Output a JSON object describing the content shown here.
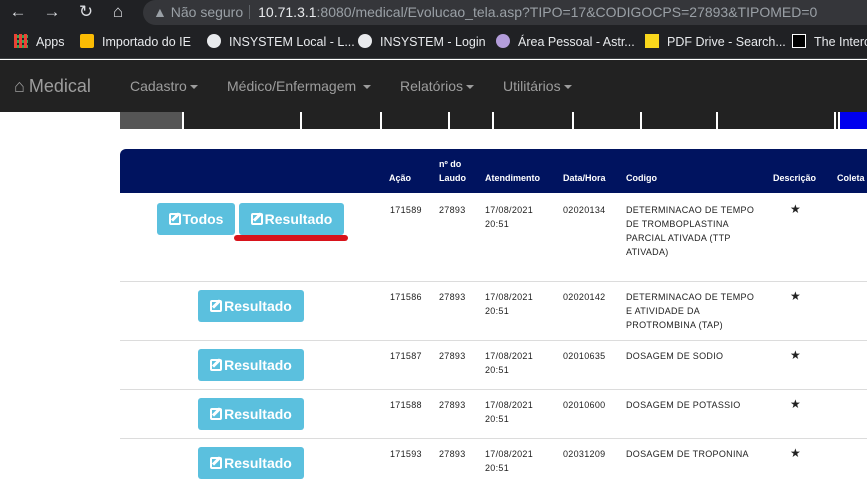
{
  "browser": {
    "security_label": "Não seguro",
    "url_host": "10.71.3.1",
    "url_rest": ":8080/medical/Evolucao_tela.asp?TIPO=17&CODIGOCPS=27893&TIPOMED=0",
    "bookmarks": [
      {
        "label": "Apps",
        "color": "#ea4335"
      },
      {
        "label": "Importado do IE",
        "color": "#fbbc04"
      },
      {
        "label": "INSYSTEM Local - L...",
        "color": "#e8eaed"
      },
      {
        "label": "INSYSTEM - Login",
        "color": "#e8eaed"
      },
      {
        "label": "Área Pessoal - Astr...",
        "color": "#b39ddb"
      },
      {
        "label": "PDF Drive - Search...",
        "color": "#f9d71c"
      },
      {
        "label": "The Interc",
        "color": "#ffffff"
      }
    ]
  },
  "navbar": {
    "brand": "Medical",
    "menus": [
      "Cadastro",
      "Médico/Enfermagem",
      "Relatórios",
      "Utilitários"
    ]
  },
  "table": {
    "headers": {
      "acao": "Ação",
      "laudo_line1": "nº do",
      "laudo_line2": "Laudo",
      "atendimento": "Atendimento",
      "datahora": "Data/Hora",
      "codigo": "Codigo",
      "descricao": "Descrição",
      "coleta": "Coleta"
    },
    "buttons": {
      "todos": "Todos",
      "resultado": "Resultado"
    },
    "star": "★",
    "rows": [
      {
        "acao": "171589",
        "laudo": "27893",
        "date": "17/08/2021",
        "time": "20:51",
        "datahora": "02020134",
        "codigo": "DETERMINACAO DE TEMPO DE TROMBOPLASTINA PARCIAL ATIVADA (TTP ATIVADA)"
      },
      {
        "acao": "171586",
        "laudo": "27893",
        "date": "17/08/2021",
        "time": "20:51",
        "datahora": "02020142",
        "codigo": "DETERMINACAO DE TEMPO E ATIVIDADE DA PROTROMBINA (TAP)"
      },
      {
        "acao": "171587",
        "laudo": "27893",
        "date": "17/08/2021",
        "time": "20:51",
        "datahora": "02010635",
        "codigo": "DOSAGEM DE SODIO"
      },
      {
        "acao": "171588",
        "laudo": "27893",
        "date": "17/08/2021",
        "time": "20:51",
        "datahora": "02010600",
        "codigo": "DOSAGEM DE POTASSIO"
      },
      {
        "acao": "171593",
        "laudo": "27893",
        "date": "17/08/2021",
        "time": "20:51",
        "datahora": "02031209",
        "codigo": "DOSAGEM DE TROPONINA"
      }
    ]
  }
}
